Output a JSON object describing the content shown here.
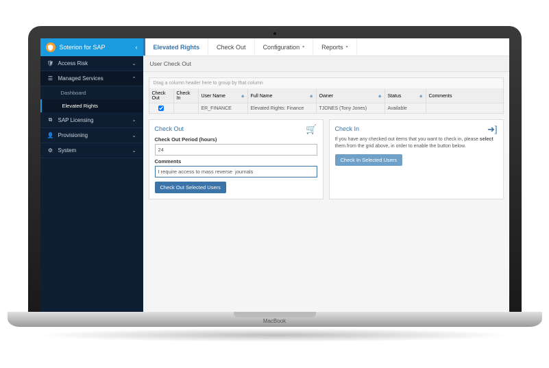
{
  "brand": {
    "title": "Soterion for SAP",
    "collapse": "‹"
  },
  "sidebar": [
    {
      "icon": "shield",
      "label": "Access Risk",
      "expanded": false,
      "children": []
    },
    {
      "icon": "layers",
      "label": "Managed Services",
      "expanded": true,
      "children": [
        {
          "label": "Dashboard",
          "active": false
        },
        {
          "label": "Elevated Rights",
          "active": true
        }
      ]
    },
    {
      "icon": "copy",
      "label": "SAP Licensing",
      "expanded": false,
      "children": []
    },
    {
      "icon": "user",
      "label": "Provisioning",
      "expanded": false,
      "children": []
    },
    {
      "icon": "gear",
      "label": "System",
      "expanded": false,
      "children": []
    }
  ],
  "topbar": {
    "title": "Elevated Rights",
    "tabs": [
      {
        "label": "Check Out",
        "caret": false
      },
      {
        "label": "Configuration",
        "caret": true
      },
      {
        "label": "Reports",
        "caret": true
      }
    ]
  },
  "page": {
    "title": "User Check Out",
    "grid": {
      "hint": "Drag a column header here to group by that column",
      "columns": [
        "Check Out",
        "Check In",
        "User Name",
        "Full Name",
        "Owner",
        "Status",
        "Comments"
      ],
      "rows": [
        {
          "check_out": true,
          "check_in": "",
          "user_name": "ER_FINANCE",
          "full_name": "Elevated Rights: Finance",
          "owner": "TJONES (Tony Jones)",
          "status": "Available",
          "comments": ""
        }
      ]
    },
    "checkout": {
      "title": "Check Out",
      "period_label": "Check Out Period (hours)",
      "period_value": "24",
      "comments_label": "Comments",
      "comments_value": "I require access to mass reverse  journals",
      "button": "Check Out Selected Users"
    },
    "checkin": {
      "title": "Check In",
      "help_1": "If you have any checked out items that you want to check in, please ",
      "help_bold": "select",
      "help_2": " them from the grid above, in order to enable the button below.",
      "button": "Check In Selected Users"
    }
  },
  "laptop_label": "MacBook"
}
